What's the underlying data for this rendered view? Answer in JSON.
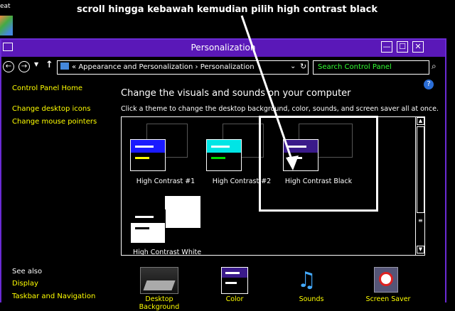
{
  "annotation": "scroll hingga kebawah kemudian pilih high contrast black",
  "desktop": {
    "label": "eat"
  },
  "window": {
    "title": "Personalization",
    "buttons": {
      "minimize": "—",
      "maximize": "☐",
      "close": "✕"
    }
  },
  "nav": {
    "back": "←",
    "forward": "→",
    "up": "↑",
    "breadcrumb": [
      "Appearance and Personalization",
      "Personalization"
    ],
    "breadcrumb_prefix": "«",
    "separator": "›",
    "dropdown": "⌄",
    "refresh": "↻",
    "search_placeholder": "Search Control Panel"
  },
  "help": "?",
  "sidebar": {
    "home": "Control Panel Home",
    "links": [
      "Change desktop icons",
      "Change mouse pointers"
    ],
    "see_also_title": "See also",
    "see_also": [
      "Display",
      "Taskbar and Navigation"
    ]
  },
  "main": {
    "heading": "Change the visuals and sounds on your computer",
    "subheading": "Click a theme to change the desktop background, color, sounds, and screen saver all at once.",
    "themes": [
      {
        "name": "High Contrast #1",
        "color": "#1a1aff",
        "accent": "#ffff00"
      },
      {
        "name": "High Contrast #2",
        "color": "#00e5e5",
        "accent": "#00d000"
      },
      {
        "name": "High Contrast Black",
        "color": "#3a1a8a",
        "accent": "#ffffff"
      },
      {
        "name": "High Contrast White",
        "color": "#ffffff",
        "accent": "#000000"
      }
    ]
  },
  "bottom": [
    {
      "label": "Desktop Background",
      "icon": "desktop-background-icon"
    },
    {
      "label": "Color",
      "icon": "color-icon"
    },
    {
      "label": "Sounds",
      "icon": "sounds-icon"
    },
    {
      "label": "Screen Saver",
      "icon": "screen-saver-icon"
    }
  ]
}
